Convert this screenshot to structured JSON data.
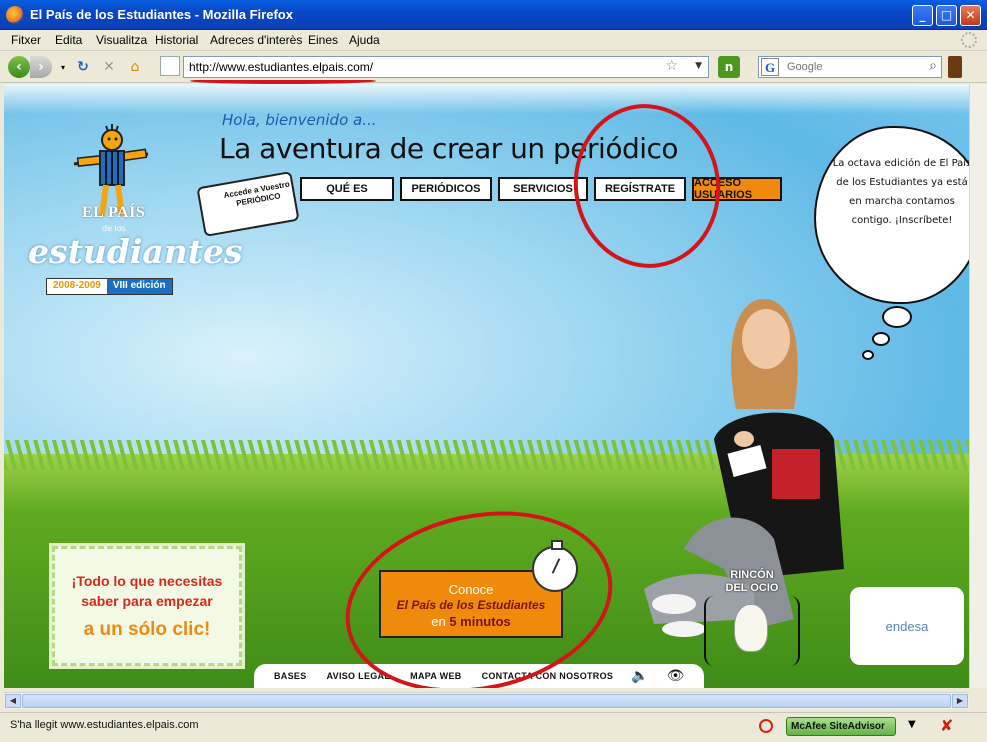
{
  "window": {
    "title": "El País de los Estudiantes - Mozilla Firefox"
  },
  "menu": [
    "Fitxer",
    "Edita",
    "Visualitza",
    "Historial",
    "Adreces d'interès",
    "Eines",
    "Ajuda"
  ],
  "nav": {
    "url": "http://www.estudiantes.elpais.com/",
    "search_placeholder": "Google"
  },
  "site": {
    "logo_top": "EL PAÍS",
    "logo_mid": "de los",
    "logo_name": "estudiantes",
    "logo_years": "2008-2009",
    "logo_edition": "VIII edición",
    "greeting": "Hola, bienvenido a...",
    "headline": "La aventura de crear un periódico",
    "badge": "Accede a Vuestro PERIÓDICO",
    "menu_items": [
      "QUÉ ES",
      "PERIÓDICOS",
      "SERVICIOS",
      "REGÍSTRATE",
      "ACCESO USUARIOS"
    ],
    "bubble_text": "La octava edición de El País de los Estudiantes ya está en marcha contamos contigo. ¡Inscríbete!",
    "promo_line1": "¡Todo lo que necesitas",
    "promo_line2": "saber para empezar",
    "promo_line3": "a un sólo clic!",
    "conoce_line1": "Conoce",
    "conoce_line2": "El País de los Estudiantes",
    "conoce_line3_pre": "en",
    "conoce_line3_bold": "5 minutos",
    "rincon_line1": "RINCÓN",
    "rincon_line2": "DEL OCIO",
    "sponsor": "endesa",
    "footer_links": [
      "BASES",
      "AVISO LEGAL",
      "MAPA WEB",
      "CONTACTA CON NOSOTROS"
    ]
  },
  "status": {
    "text": "S'ha llegit www.estudiantes.elpais.com",
    "mcafee": "McAfee SiteAdvisor"
  },
  "colors": {
    "accent": "#f08a0c",
    "annotation": "#d3141a",
    "title_bar": "#0748c8"
  }
}
